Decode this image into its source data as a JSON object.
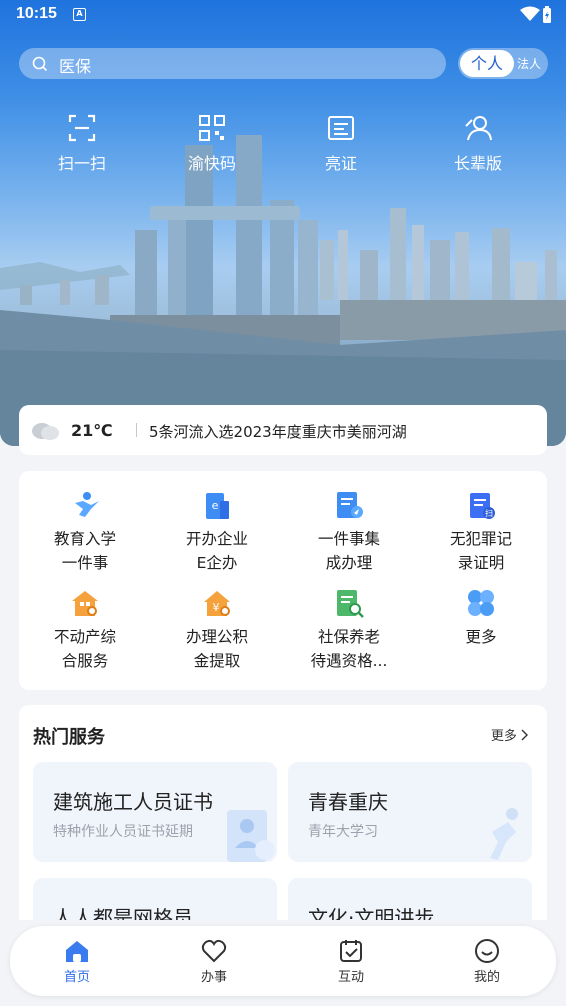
{
  "status_bar": {
    "time": "10:15",
    "notification_icon": "A"
  },
  "search": {
    "placeholder": "医保",
    "mode_active": "个人",
    "mode_inactive": "法人"
  },
  "quick_actions": [
    {
      "label": "扫一扫",
      "icon": "scan-icon"
    },
    {
      "label": "渝快码",
      "icon": "qr-code-icon"
    },
    {
      "label": "亮证",
      "icon": "id-card-icon"
    },
    {
      "label": "长辈版",
      "icon": "elder-mode-icon"
    }
  ],
  "weather": {
    "temperature": "21℃",
    "icon": "cloud-icon"
  },
  "news": {
    "headline": "5条河流入选2023年度重庆市美丽河湖"
  },
  "services": [
    {
      "line1": "教育入学",
      "line2": "一件事",
      "icon": "education-icon"
    },
    {
      "line1": "开办企业",
      "line2": "E企办",
      "icon": "enterprise-icon"
    },
    {
      "line1": "一件事集",
      "line2": "成办理",
      "icon": "integrated-service-icon"
    },
    {
      "line1": "无犯罪记",
      "line2": "录证明",
      "icon": "no-criminal-record-icon"
    },
    {
      "line1": "不动产综",
      "line2": "合服务",
      "icon": "real-estate-icon"
    },
    {
      "line1": "办理公积",
      "line2": "金提取",
      "icon": "housing-fund-icon"
    },
    {
      "line1": "社保养老",
      "line2": "待遇资格...",
      "icon": "social-security-icon"
    },
    {
      "line1": "更多",
      "line2": "",
      "icon": "more-grid-icon"
    }
  ],
  "hot_services": {
    "title": "热门服务",
    "more_label": "更多",
    "cards": [
      {
        "title": "建筑施工人员证书",
        "subtitle": "特种作业人员证书延期"
      },
      {
        "title": "青春重庆",
        "subtitle": "青年大学习"
      },
      {
        "title": "人人都是网格员",
        "subtitle": ""
      },
      {
        "title": "文化·文明讲步",
        "subtitle": ""
      }
    ]
  },
  "tabs": [
    {
      "label": "首页",
      "icon": "home-icon",
      "active": true
    },
    {
      "label": "办事",
      "icon": "heart-icon",
      "active": false
    },
    {
      "label": "互动",
      "icon": "calendar-check-icon",
      "active": false
    },
    {
      "label": "我的",
      "icon": "smile-icon",
      "active": false
    }
  ],
  "colors": {
    "accent": "#2f6ee6",
    "sky_top": "#1f73dd",
    "card_bg": "#f0f4fb"
  }
}
